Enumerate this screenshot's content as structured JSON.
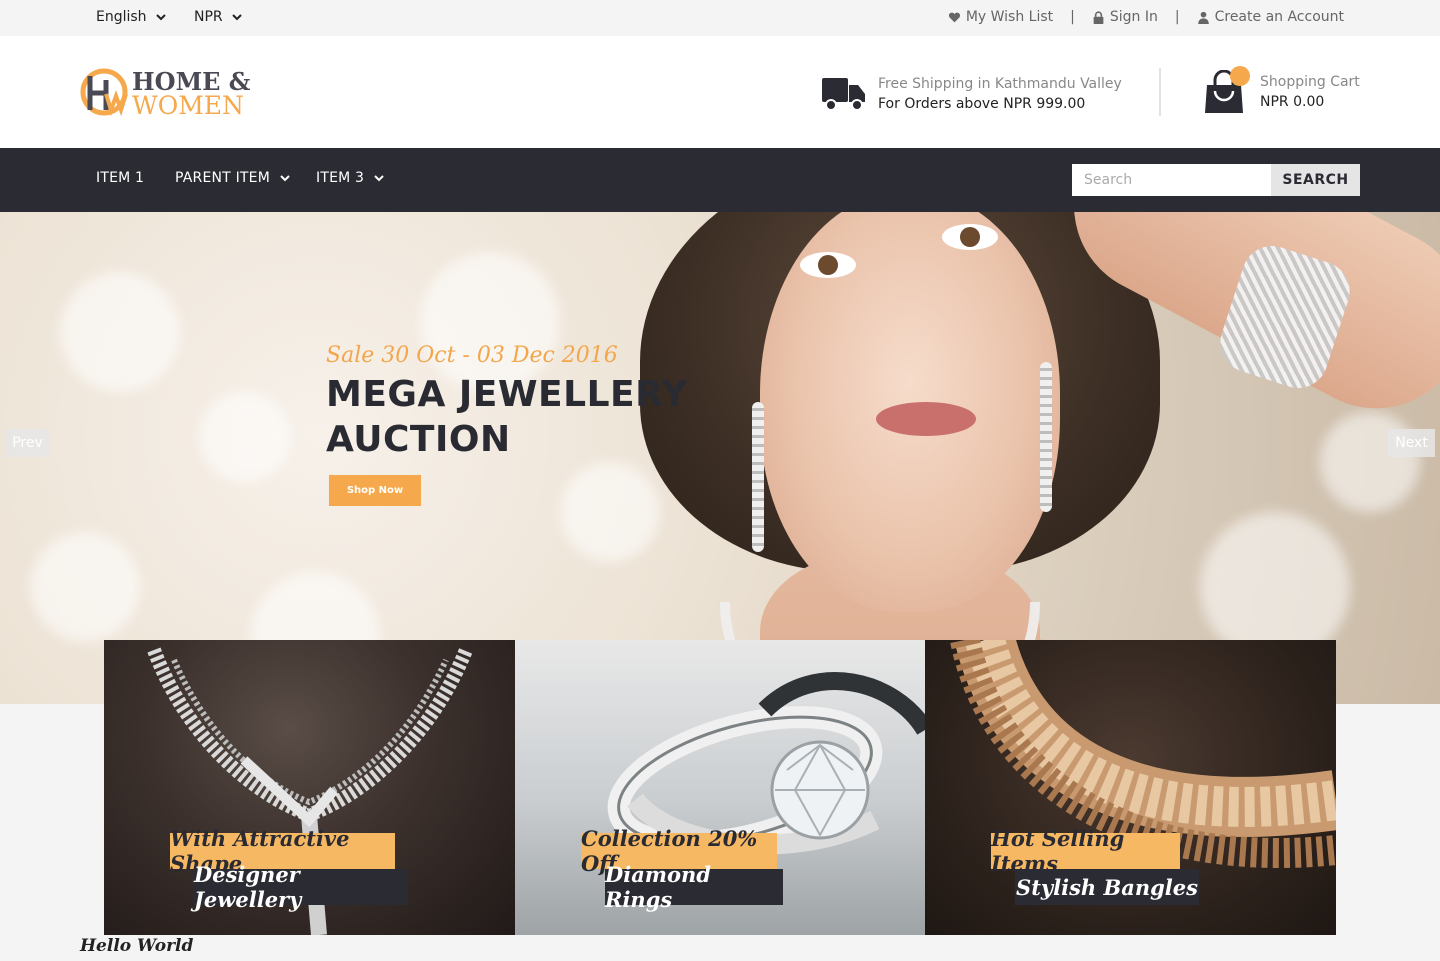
{
  "topbar": {
    "language": "English",
    "currency": "NPR",
    "wishlist": "My Wish List",
    "separator": "|",
    "signin": "Sign In",
    "create_account": "Create an Account"
  },
  "header": {
    "logo_line1": "HOME &",
    "logo_line2": "WOMEN",
    "shipping_title": "Free Shipping in Kathmandu Valley",
    "shipping_sub": "For Orders above NPR 999.00",
    "cart_title": "Shopping Cart",
    "cart_amount": "NPR 0.00"
  },
  "nav": {
    "items": [
      "ITEM 1",
      "PARENT ITEM",
      "ITEM 3"
    ],
    "search_placeholder": "Search",
    "search_button": "SEARCH"
  },
  "hero": {
    "sale_text": "Sale 30 Oct - 03 Dec 2016",
    "headline_line1": "MEGA JEWELLERY",
    "headline_line2": "AUCTION",
    "cta": "Shop Now",
    "prev": "Prev",
    "next": "Next"
  },
  "banners": [
    {
      "top": "With Attractive Shape",
      "bottom": "Designer Jewellery"
    },
    {
      "top": "Collection 20% Off",
      "bottom": "Diamond Rings"
    },
    {
      "top": "Hot Selling Items",
      "bottom": "Stylish Bangles"
    }
  ],
  "footer_text": "Hello World",
  "colors": {
    "accent": "#f6a84c",
    "dark": "#2b2b34",
    "topbar_bg": "#f4f4f4"
  },
  "icons": [
    "chevron-down-icon",
    "heart-icon",
    "lock-icon",
    "user-icon",
    "truck-icon",
    "shopping-bag-icon"
  ]
}
